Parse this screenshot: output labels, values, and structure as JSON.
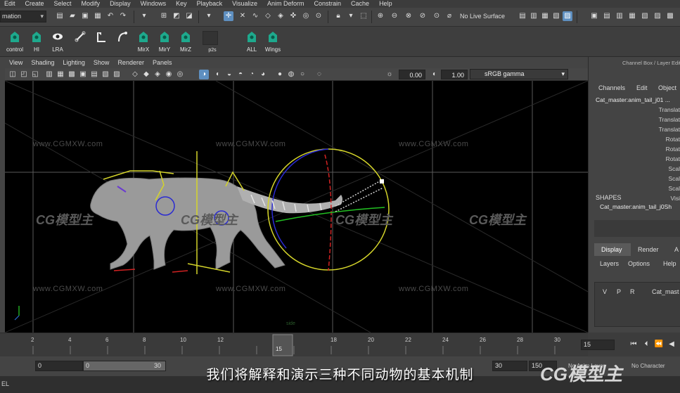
{
  "menubar": [
    "Edit",
    "Create",
    "Select",
    "Modify",
    "Display",
    "Windows",
    "Key",
    "Playback",
    "Visualize",
    "Anim Deform",
    "Constrain",
    "Cache",
    "Help"
  ],
  "statusline": {
    "mode": "mation",
    "live_surface": "No Live Surface"
  },
  "shelf": {
    "buttons": [
      "control",
      "HI",
      "LRA",
      "",
      "",
      "",
      "MirX",
      "MirY",
      "MirZ",
      "p2s",
      "ALL",
      "Wings"
    ]
  },
  "viewport_menu": [
    "View",
    "Shading",
    "Lighting",
    "Show",
    "Renderer",
    "Panels"
  ],
  "viewport_toolbar": {
    "exposure": "0.00",
    "gamma": "1.00",
    "colorspace": "sRGB gamma"
  },
  "watermark": {
    "url": "www.CGMXW.com",
    "logo": "CG模型主"
  },
  "viewport_hud": {
    "persp": "side"
  },
  "channel_box": {
    "header": "Channel Box / Layer Edit",
    "tabs": [
      "Channels",
      "Edit",
      "Object"
    ],
    "object_name": "Cat_master:anim_tail_j01 ...",
    "attrs": [
      "Translat",
      "Translat",
      "Translat",
      "Rotat",
      "Rotat",
      "Rotat",
      "Scal",
      "Scal",
      "Scal",
      "Visi"
    ],
    "shapes_label": "SHAPES",
    "shape_name": "Cat_master:anim_tail_j0Sh"
  },
  "layer_editor": {
    "tabs": [
      "Display",
      "Render",
      "A"
    ],
    "menu": [
      "Layers",
      "Options",
      "Help"
    ],
    "columns": [
      "V",
      "P",
      "R"
    ],
    "layer_name": "Cat_mast"
  },
  "timeline": {
    "ticks": [
      "2",
      "4",
      "6",
      "8",
      "10",
      "12",
      "15",
      "18",
      "20",
      "22",
      "24",
      "26",
      "28",
      "30"
    ],
    "current_frame": "15",
    "current_field": "15"
  },
  "range": {
    "start": "0",
    "inner_start": "0",
    "inner_end": "30",
    "end_a": "30",
    "end_b": "150",
    "anim_layer": "No Anim Layer",
    "char_set": "No Character"
  },
  "subtitle": "我们将解释和演示三种不同动物的基本机制",
  "bottom_left": "EL",
  "brand": "CG模型主",
  "colors": {
    "accent_blue": "#5e8fc0",
    "viewport_bg": "#000000",
    "ring_yellow": "#d4d42a",
    "ring_red": "#d22222",
    "ring_blue": "#2a2ad2",
    "ring_green": "#22c022"
  }
}
